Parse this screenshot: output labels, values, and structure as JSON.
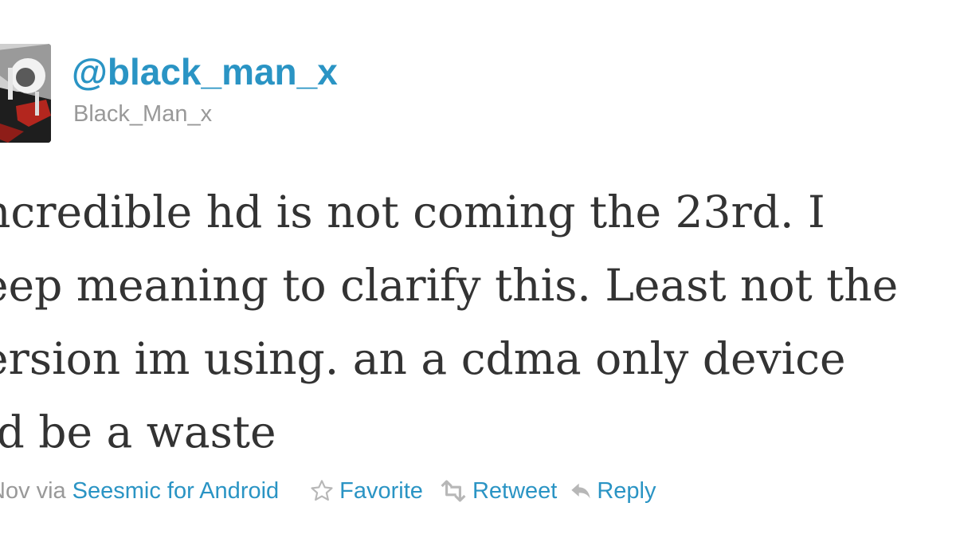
{
  "tweet": {
    "handle": "@black_man_x",
    "display_name": "Black_Man_x",
    "text_lines": [
      "ncredible hd is not coming the 23rd. I",
      "eep meaning to clarify this. Least not the",
      "ersion im using. an a cdma only device",
      "ld be a waste"
    ],
    "timestamp": "Nov",
    "via_label": "via",
    "client": "Seesmic for Android",
    "actions": {
      "favorite": "Favorite",
      "retweet": "Retweet",
      "reply": "Reply"
    }
  },
  "colors": {
    "link": "#2a94c4",
    "muted": "#999999",
    "body_text": "#333333",
    "icon": "#b7b7b7"
  },
  "icons": {
    "favorite": "star-outline-icon",
    "retweet": "retweet-icon",
    "reply": "reply-arrow-icon"
  }
}
